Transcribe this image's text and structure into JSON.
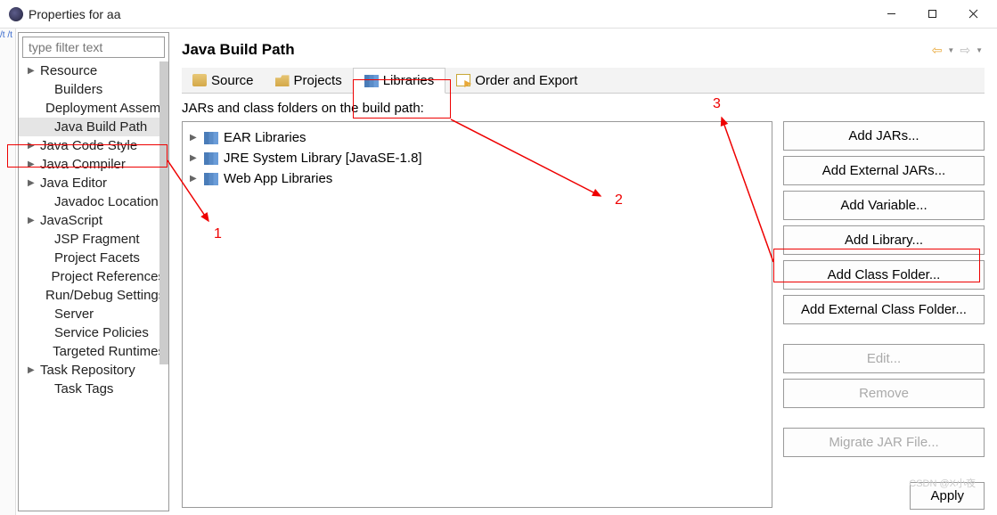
{
  "window": {
    "title": "Properties for aa"
  },
  "leftMargin": "/t\n/t",
  "sidebar": {
    "filterPlaceholder": "type filter text",
    "items": [
      {
        "label": "Resource",
        "expandable": true,
        "child": false
      },
      {
        "label": "Builders",
        "expandable": false,
        "child": true
      },
      {
        "label": "Deployment Assembly",
        "expandable": false,
        "child": true
      },
      {
        "label": "Java Build Path",
        "expandable": false,
        "child": true,
        "selected": true
      },
      {
        "label": "Java Code Style",
        "expandable": true,
        "child": false
      },
      {
        "label": "Java Compiler",
        "expandable": true,
        "child": false
      },
      {
        "label": "Java Editor",
        "expandable": true,
        "child": false
      },
      {
        "label": "Javadoc Location",
        "expandable": false,
        "child": true
      },
      {
        "label": "JavaScript",
        "expandable": true,
        "child": false
      },
      {
        "label": "JSP Fragment",
        "expandable": false,
        "child": true
      },
      {
        "label": "Project Facets",
        "expandable": false,
        "child": true
      },
      {
        "label": "Project References",
        "expandable": false,
        "child": true
      },
      {
        "label": "Run/Debug Settings",
        "expandable": false,
        "child": true
      },
      {
        "label": "Server",
        "expandable": false,
        "child": true
      },
      {
        "label": "Service Policies",
        "expandable": false,
        "child": true
      },
      {
        "label": "Targeted Runtimes",
        "expandable": false,
        "child": true
      },
      {
        "label": "Task Repository",
        "expandable": true,
        "child": false
      },
      {
        "label": "Task Tags",
        "expandable": false,
        "child": true
      }
    ]
  },
  "content": {
    "title": "Java Build Path",
    "tabs": [
      {
        "label": "Source",
        "icon": "source"
      },
      {
        "label": "Projects",
        "icon": "projects"
      },
      {
        "label": "Libraries",
        "icon": "libraries",
        "active": true
      },
      {
        "label": "Order and Export",
        "icon": "order"
      }
    ],
    "subtitle": "JARs and class folders on the build path:",
    "libraries": [
      {
        "label": "EAR Libraries"
      },
      {
        "label": "JRE System Library [JavaSE-1.8]"
      },
      {
        "label": "Web App Libraries"
      }
    ],
    "buttons": [
      {
        "label": "Add JARs...",
        "disabled": false
      },
      {
        "label": "Add External JARs...",
        "disabled": false
      },
      {
        "label": "Add Variable...",
        "disabled": false
      },
      {
        "label": "Add Library...",
        "disabled": false,
        "highlight": true
      },
      {
        "label": "Add Class Folder...",
        "disabled": false
      },
      {
        "label": "Add External Class Folder...",
        "disabled": false
      },
      {
        "gap": true
      },
      {
        "label": "Edit...",
        "disabled": true
      },
      {
        "label": "Remove",
        "disabled": true
      },
      {
        "gap": true
      },
      {
        "label": "Migrate JAR File...",
        "disabled": true
      }
    ]
  },
  "bottom": {
    "apply": "Apply"
  },
  "watermark": "CSDN @X小夜",
  "annotations": {
    "n1": "1",
    "n2": "2",
    "n3": "3"
  }
}
